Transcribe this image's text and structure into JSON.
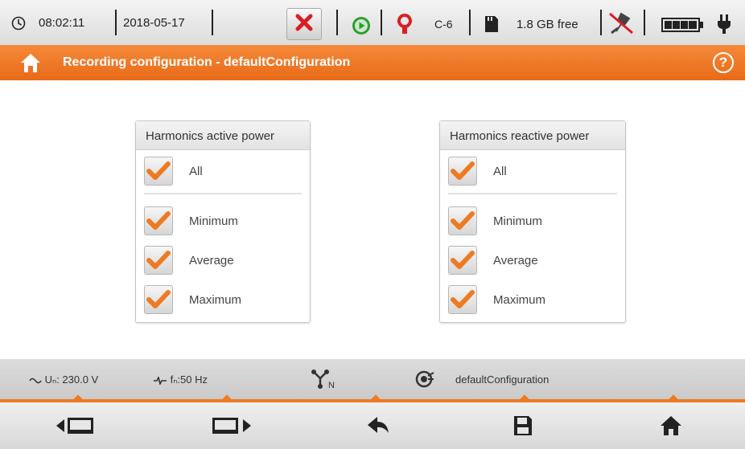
{
  "status": {
    "time": "08:02:11",
    "date": "2018-05-17",
    "clamp": "C-6",
    "storage_free": "1.8 GB free"
  },
  "title": {
    "text": "Recording configuration - defaultConfiguration"
  },
  "panels": [
    {
      "header": "Harmonics active power",
      "items": [
        {
          "label": "All",
          "checked": true
        },
        {
          "label": "Minimum",
          "checked": true
        },
        {
          "label": "Average",
          "checked": true
        },
        {
          "label": "Maximum",
          "checked": true
        }
      ]
    },
    {
      "header": "Harmonics reactive power",
      "items": [
        {
          "label": "All",
          "checked": true
        },
        {
          "label": "Minimum",
          "checked": true
        },
        {
          "label": "Average",
          "checked": true
        },
        {
          "label": "Maximum",
          "checked": true
        }
      ]
    }
  ],
  "info": {
    "voltage_label": "Uₙ: 230.0 V",
    "freq_label": "fₙ:50 Hz",
    "network_symbol": "N",
    "config_name": "defaultConfiguration"
  },
  "colors": {
    "accent": "#ee7a22",
    "check": "#ee7a22",
    "stop": "#d81f26",
    "play": "#2f9e2f"
  },
  "icons": {
    "clock": "clock-icon",
    "stop": "stop-recording-icon",
    "play": "play-icon",
    "clamp": "clamp-icon",
    "sd": "sd-card-icon",
    "usb": "usb-disconnected-icon",
    "battery": "battery-icon",
    "plug": "power-plug-icon",
    "home": "home-icon",
    "help": "help-icon"
  }
}
